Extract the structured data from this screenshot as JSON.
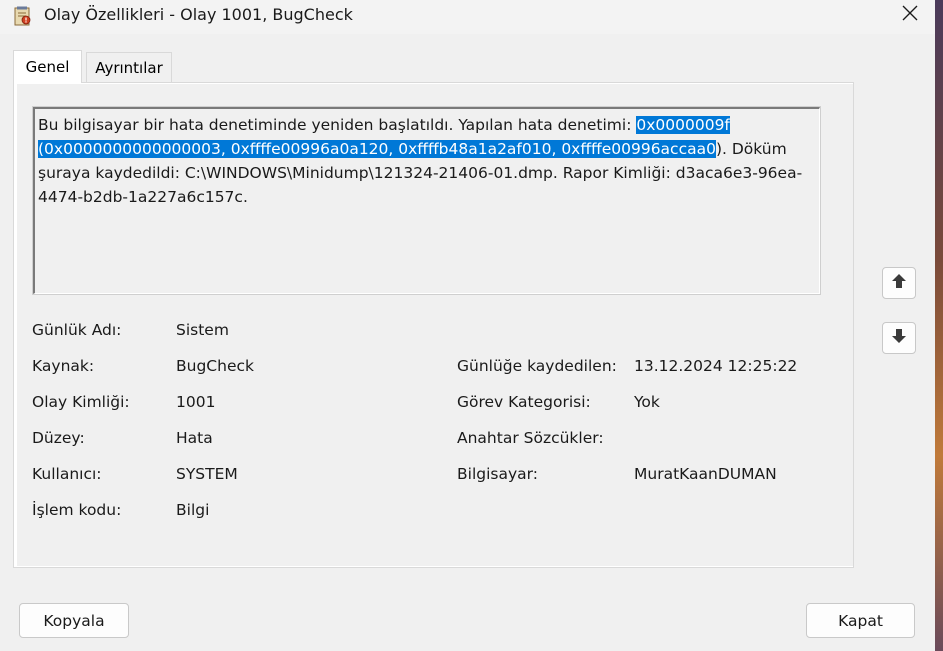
{
  "window": {
    "title": "Olay Özellikleri - Olay 1001, BugCheck",
    "app_icon": "event-viewer-icon",
    "close_icon": "close-icon"
  },
  "tabs": [
    {
      "label": "Genel",
      "active": true
    },
    {
      "label": "Ayrıntılar",
      "active": false
    }
  ],
  "description": {
    "before": "Bu bilgisayar bir hata denetiminde yeniden başlatıldı. Yapılan hata denetimi: ",
    "selected": "0x0000009f (0x0000000000000003, 0xffffe00996a0a120, 0xffffb48a1a2af010, 0xffffe00996accaa0",
    "after": "). Döküm şuraya kaydedildi: C:\\WINDOWS\\Minidump\\121324-21406-01.dmp. Rapor Kimliği: d3aca6e3-96ea-4474-b2db-1a227a6c157c."
  },
  "fields": {
    "log_name": {
      "label": "Günlük Adı:",
      "value": "Sistem"
    },
    "source": {
      "label": "Kaynak:",
      "value": "BugCheck"
    },
    "event_id": {
      "label": "Olay Kimliği:",
      "value": "1001"
    },
    "level": {
      "label": "Düzey:",
      "value": "Hata"
    },
    "user": {
      "label": "Kullanıcı:",
      "value": "SYSTEM"
    },
    "opcode": {
      "label": "İşlem kodu:",
      "value": "Bilgi"
    },
    "logged": {
      "label": "Günlüğe kaydedilen:",
      "value": "13.12.2024 12:25:22"
    },
    "task_category": {
      "label": "Görev Kategorisi:",
      "value": "Yok"
    },
    "keywords": {
      "label": "Anahtar Sözcükler:",
      "value": ""
    },
    "computer": {
      "label": "Bilgisayar:",
      "value": "MuratKaanDUMAN"
    }
  },
  "navigation": {
    "up_icon": "arrow-up-icon",
    "down_icon": "arrow-down-icon"
  },
  "buttons": {
    "copy": "Kopyala",
    "close": "Kapat"
  },
  "colors": {
    "selection": "#0078d7",
    "window_bg": "#f0f0f0",
    "panel_bg": "#ffffff"
  }
}
